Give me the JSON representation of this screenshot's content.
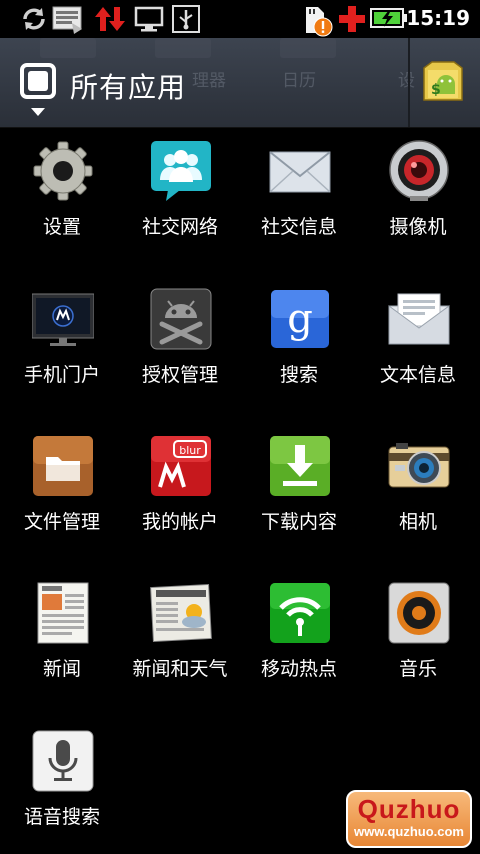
{
  "status_bar": {
    "time": "15:19",
    "icons": [
      "sync-icon",
      "keyboard-icon",
      "data-activity-icon",
      "monitor-icon",
      "usb-icon",
      "sd-warning-icon",
      "add-icon",
      "battery-charging-icon"
    ]
  },
  "header": {
    "title": "所有应用",
    "background_tabs": [
      "理器",
      "日历",
      "设"
    ],
    "market_icon": "android-market-icon"
  },
  "apps": [
    {
      "label": "设置",
      "icon": "settings-gear-icon"
    },
    {
      "label": "社交网络",
      "icon": "social-network-icon"
    },
    {
      "label": "社交信息",
      "icon": "envelope-icon"
    },
    {
      "label": "摄像机",
      "icon": "camcorder-icon"
    },
    {
      "label": "手机门户",
      "icon": "motorola-monitor-icon"
    },
    {
      "label": "授权管理",
      "icon": "android-crossbones-icon"
    },
    {
      "label": "搜索",
      "icon": "google-search-icon"
    },
    {
      "label": "文本信息",
      "icon": "message-envelope-icon"
    },
    {
      "label": "文件管理",
      "icon": "folder-icon"
    },
    {
      "label": "我的帐户",
      "icon": "blur-account-icon"
    },
    {
      "label": "下载内容",
      "icon": "download-icon"
    },
    {
      "label": "相机",
      "icon": "camera-icon"
    },
    {
      "label": "新闻",
      "icon": "newspaper-icon"
    },
    {
      "label": "新闻和天气",
      "icon": "news-weather-icon"
    },
    {
      "label": "移动热点",
      "icon": "wifi-hotspot-icon"
    },
    {
      "label": "音乐",
      "icon": "speaker-music-icon"
    },
    {
      "label": "语音搜索",
      "icon": "microphone-icon"
    }
  ],
  "watermark": {
    "brand": "Quzhuo",
    "url": "www.quzhuo.com"
  },
  "colors": {
    "background": "#000000",
    "header": "#343a44",
    "accent_red": "#e0201e",
    "battery_green": "#4fd13a"
  }
}
